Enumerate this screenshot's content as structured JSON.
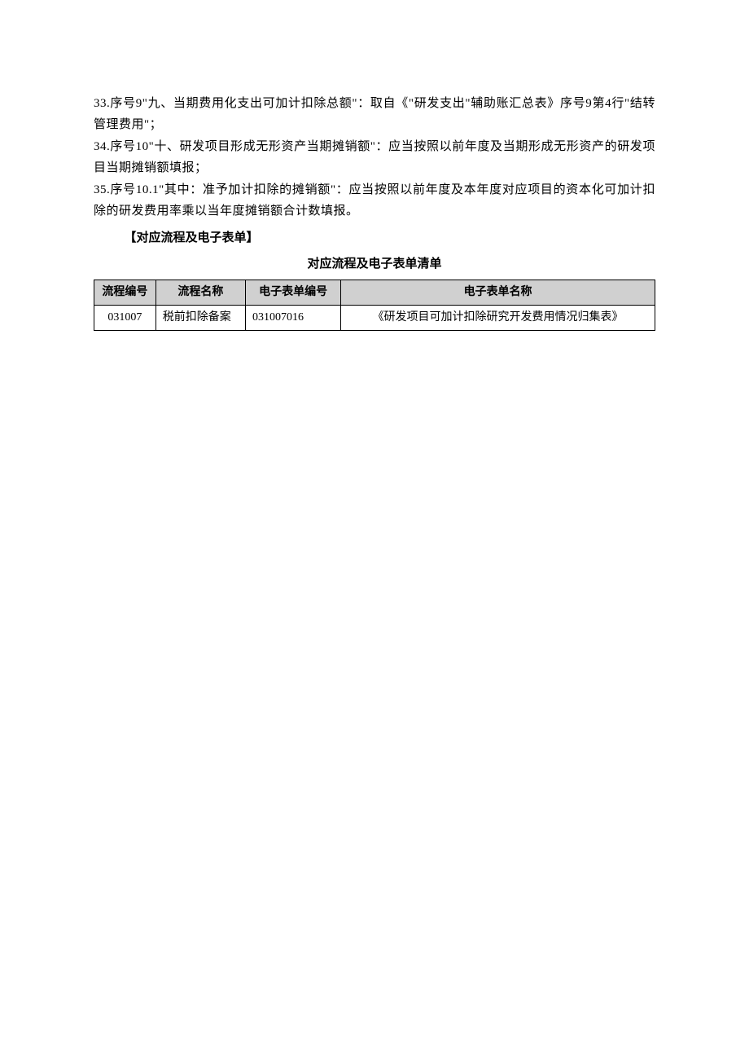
{
  "paragraphs": {
    "p33": "33.序号9\"九、当期费用化支出可加计扣除总额\"：取自《\"研发支出\"辅助账汇总表》序号9第4行\"结转管理费用\"；",
    "p34": "34.序号10\"十、研发项目形成无形资产当期摊销额\"：应当按照以前年度及当期形成无形资产的研发项目当期摊销额填报；",
    "p35": "35.序号10.1\"其中：准予加计扣除的摊销额\"：应当按照以前年度及本年度对应项目的资本化可加计扣除的研发费用率乘以当年度摊销额合计数填报。"
  },
  "section_header": "【对应流程及电子表单】",
  "table": {
    "title": "对应流程及电子表单清单",
    "headers": {
      "h1": "流程编号",
      "h2": "流程名称",
      "h3": "电子表单编号",
      "h4": "电子表单名称"
    },
    "row1": {
      "c1": "031007",
      "c2": "税前扣除备案",
      "c3": "031007016",
      "c4": "《研发项目可加计扣除研究开发费用情况归集表》"
    }
  }
}
